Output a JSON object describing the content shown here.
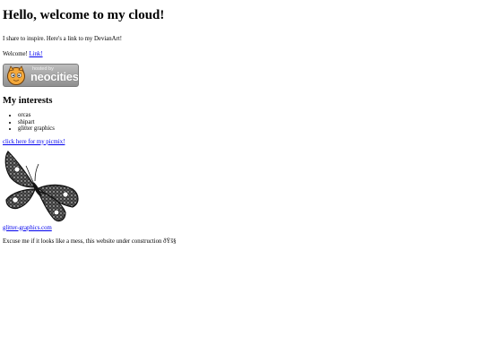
{
  "page": {
    "heading": "Hello, welcome to my cloud!",
    "intro": "I share to inspire. Here's a link to my DevianArt!",
    "welcome_prefix": "Welcome!",
    "welcome_link": "Link!",
    "badge": {
      "hosted_by": "hosted by",
      "brand": "neocities"
    },
    "interests_heading": "My interests",
    "interests": [
      "orcas",
      "shipart",
      "glitter graphics"
    ],
    "picmix_link": "click here for my picmix!",
    "glitter_link": "glitter-graphics.com",
    "construction_note": "Excuse me if it looks like a mess, this website under construction ðŸš§"
  },
  "icons": {
    "badge_mascot": "neocities-cat-icon",
    "butterfly": "glitter-butterfly-image"
  },
  "colors": {
    "link": "#0000ee",
    "background": "#ffffff",
    "badge_gray": "#a6a6a6"
  }
}
